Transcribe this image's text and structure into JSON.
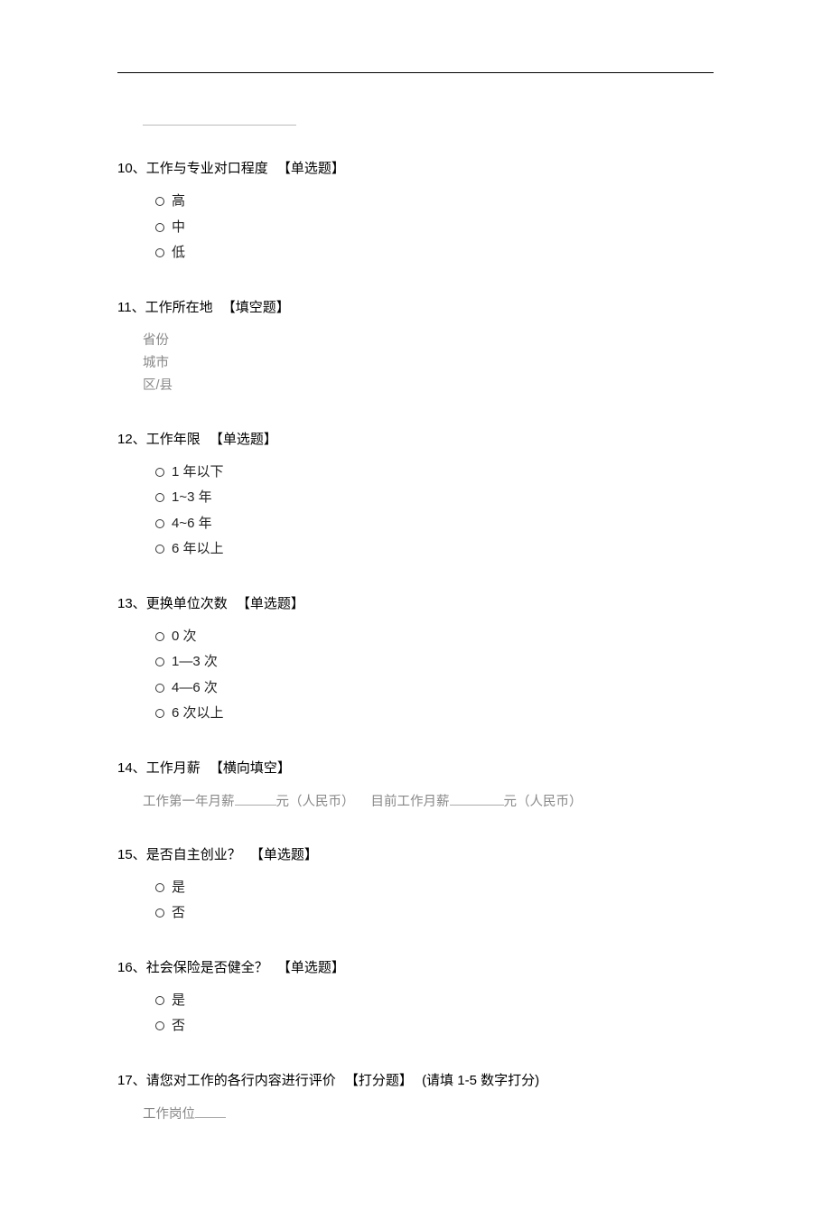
{
  "q10": {
    "num": "10、",
    "title": "工作与专业对口程度",
    "type": "【单选题】",
    "options": [
      "高",
      "中",
      "低"
    ]
  },
  "q11": {
    "num": "11、",
    "title": "工作所在地",
    "type": "【填空题】",
    "fields": [
      "省份",
      "城市",
      "区/县"
    ]
  },
  "q12": {
    "num": "12、",
    "title": "工作年限",
    "type": "【单选题】",
    "options": [
      "1 年以下",
      "1~3 年",
      "4~6 年",
      "6 年以上"
    ]
  },
  "q13": {
    "num": "13、",
    "title": "更换单位次数",
    "type": "【单选题】",
    "options": [
      "0 次",
      "1—3 次",
      "4—6 次",
      "6 次以上"
    ]
  },
  "q14": {
    "num": "14、",
    "title": "工作月薪",
    "type": "【横向填空】",
    "prefix1": "工作第一年月薪",
    "suffix1": "元（人民币）",
    "prefix2": "目前工作月薪",
    "suffix2": "元（人民币）"
  },
  "q15": {
    "num": "15、",
    "title": "是否自主创业？",
    "type": "【单选题】",
    "options": [
      "是",
      "否"
    ]
  },
  "q16": {
    "num": "16、",
    "title": "社会保险是否健全？",
    "type": "【单选题】",
    "options": [
      "是",
      "否"
    ]
  },
  "q17": {
    "num": "17、",
    "title": "请您对工作的各行内容进行评价",
    "type": "【打分题】",
    "note": "(请填 1-5 数字打分)",
    "field1": "工作岗位"
  }
}
